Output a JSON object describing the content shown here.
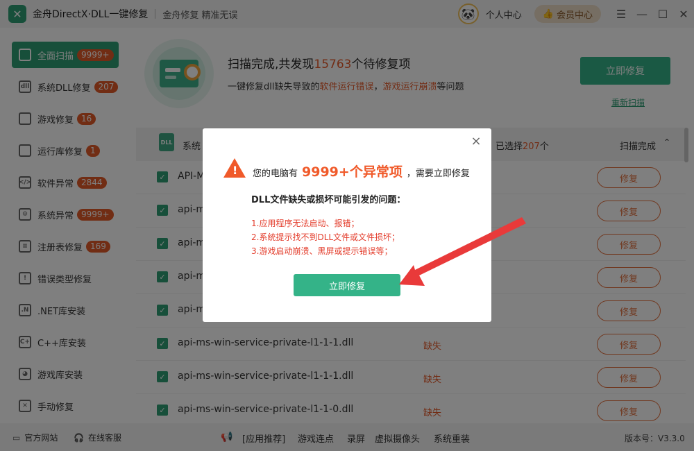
{
  "app": {
    "title": "金舟DirectX·DLL一键修复",
    "slogan": "金舟修复 精准无误",
    "logo_icon": "tools-icon",
    "personal_center": "个人中心",
    "vip_center": "会员中心"
  },
  "sidebar": {
    "items": [
      {
        "label": "全面扫描",
        "badge": "9999+",
        "icon": "scan-icon",
        "active": true
      },
      {
        "label": "系统DLL修复",
        "badge": "207",
        "icon": "dll-icon"
      },
      {
        "label": "游戏修复",
        "badge": "16",
        "icon": "gamepad-icon"
      },
      {
        "label": "运行库修复",
        "badge": "1",
        "icon": "vs-icon"
      },
      {
        "label": "软件异常",
        "badge": "2844",
        "icon": "code-icon"
      },
      {
        "label": "系统异常",
        "badge": "9999+",
        "icon": "gear-icon"
      },
      {
        "label": "注册表修复",
        "badge": "169",
        "icon": "registry-icon"
      },
      {
        "label": "错误类型修复",
        "badge": "",
        "icon": "warning-icon"
      },
      {
        "label": ".NET库安装",
        "badge": "",
        "icon": "dotnet-icon"
      },
      {
        "label": "C++库安装",
        "badge": "",
        "icon": "cpp-icon"
      },
      {
        "label": "游戏库安装",
        "badge": "",
        "icon": "pacman-icon"
      },
      {
        "label": "手动修复",
        "badge": "",
        "icon": "wrench-icon"
      }
    ]
  },
  "scan": {
    "title_prefix": "扫描完成,共发现",
    "count": "15763",
    "title_suffix": "个待修复项",
    "sub_prefix": "一键修复dll缺失导致的",
    "sub_hl1": "软件运行错误",
    "sub_mid": "，",
    "sub_hl2": "游戏运行崩溃",
    "sub_suffix": "等问题",
    "fix_now": "立即修复",
    "rescan": "重新扫描"
  },
  "list": {
    "header": {
      "icon_text": "DLL",
      "label": "系统",
      "selected_prefix": "已选择",
      "selected_count": "207",
      "selected_suffix": "个",
      "status": "扫描完成",
      "chevron": "⌃"
    },
    "rows": [
      {
        "name": "API-M",
        "status": "",
        "fix": "修复"
      },
      {
        "name": "api-m",
        "status": "",
        "fix": "修复"
      },
      {
        "name": "api-m",
        "status": "",
        "fix": "修复"
      },
      {
        "name": "api-m",
        "status": "",
        "fix": "修复"
      },
      {
        "name": "api-m",
        "status": "",
        "fix": "修复"
      },
      {
        "name": "api-ms-win-service-private-l1-1-1.dll",
        "status": "缺失",
        "fix": "修复"
      },
      {
        "name": "api-ms-win-service-private-l1-1-1.dll",
        "status": "缺失",
        "fix": "修复"
      },
      {
        "name": "api-ms-win-service-private-l1-1-0.dll",
        "status": "缺失",
        "fix": "修复"
      }
    ]
  },
  "footer": {
    "official_site": "官方网站",
    "online_service": "在线客服",
    "recommend": "[应用推荐]",
    "links": [
      "游戏连点",
      "录屏",
      "虚拟摄像头",
      "系统重装"
    ],
    "version": "版本号：V3.3.0"
  },
  "modal": {
    "title_prefix": "您的电脑有",
    "title_big": "9999+个异常项",
    "title_suffix": "，需要立即修复",
    "subtitle": "DLL文件缺失或损坏可能引发的问题：",
    "problems": [
      "1.应用程序无法启动、报错；",
      "2.系统提示找不到DLL文件或文件损坏；",
      "3.游戏启动崩溃、黑屏或提示错误等；"
    ],
    "fix_button": "立即修复",
    "close": "×"
  },
  "colors": {
    "brand_green": "#2f9e74",
    "accent_orange": "#e55a2a",
    "arrow_red": "#e93a3a"
  }
}
